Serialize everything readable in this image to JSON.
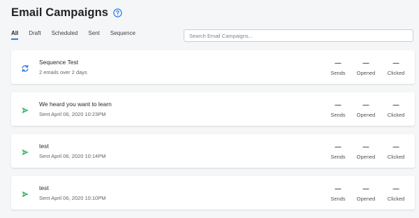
{
  "page": {
    "title": "Email Campaigns",
    "help_icon": "help-circle-icon"
  },
  "tabs": [
    {
      "label": "All",
      "active": true
    },
    {
      "label": "Draft",
      "active": false
    },
    {
      "label": "Scheduled",
      "active": false
    },
    {
      "label": "Sent",
      "active": false
    },
    {
      "label": "Sequence",
      "active": false
    }
  ],
  "search": {
    "placeholder": "Search Email Campaigns...",
    "value": ""
  },
  "stat_labels": {
    "sends": "Sends",
    "opened": "Opened",
    "clicked": "Clicked"
  },
  "colors": {
    "accent": "#2d7be5",
    "sent_icon": "#3ab26a",
    "sequence_icon": "#2d7be5"
  },
  "campaigns": [
    {
      "icon": "sequence-sync-icon",
      "title": "Sequence Test",
      "subtitle": "2 emails over 2 days",
      "sends": "—",
      "opened": "—",
      "clicked": "—"
    },
    {
      "icon": "sent-paper-plane-icon",
      "title": "We heard you want to learn",
      "subtitle": "Sent April 06, 2020 10:23PM",
      "sends": "—",
      "opened": "—",
      "clicked": "—"
    },
    {
      "icon": "sent-paper-plane-icon",
      "title": "test",
      "subtitle": "Sent April 06, 2020 10:14PM",
      "sends": "—",
      "opened": "—",
      "clicked": "—"
    },
    {
      "icon": "sent-paper-plane-icon",
      "title": "test",
      "subtitle": "Sent April 06, 2020 10:10PM",
      "sends": "—",
      "opened": "—",
      "clicked": "—"
    }
  ]
}
